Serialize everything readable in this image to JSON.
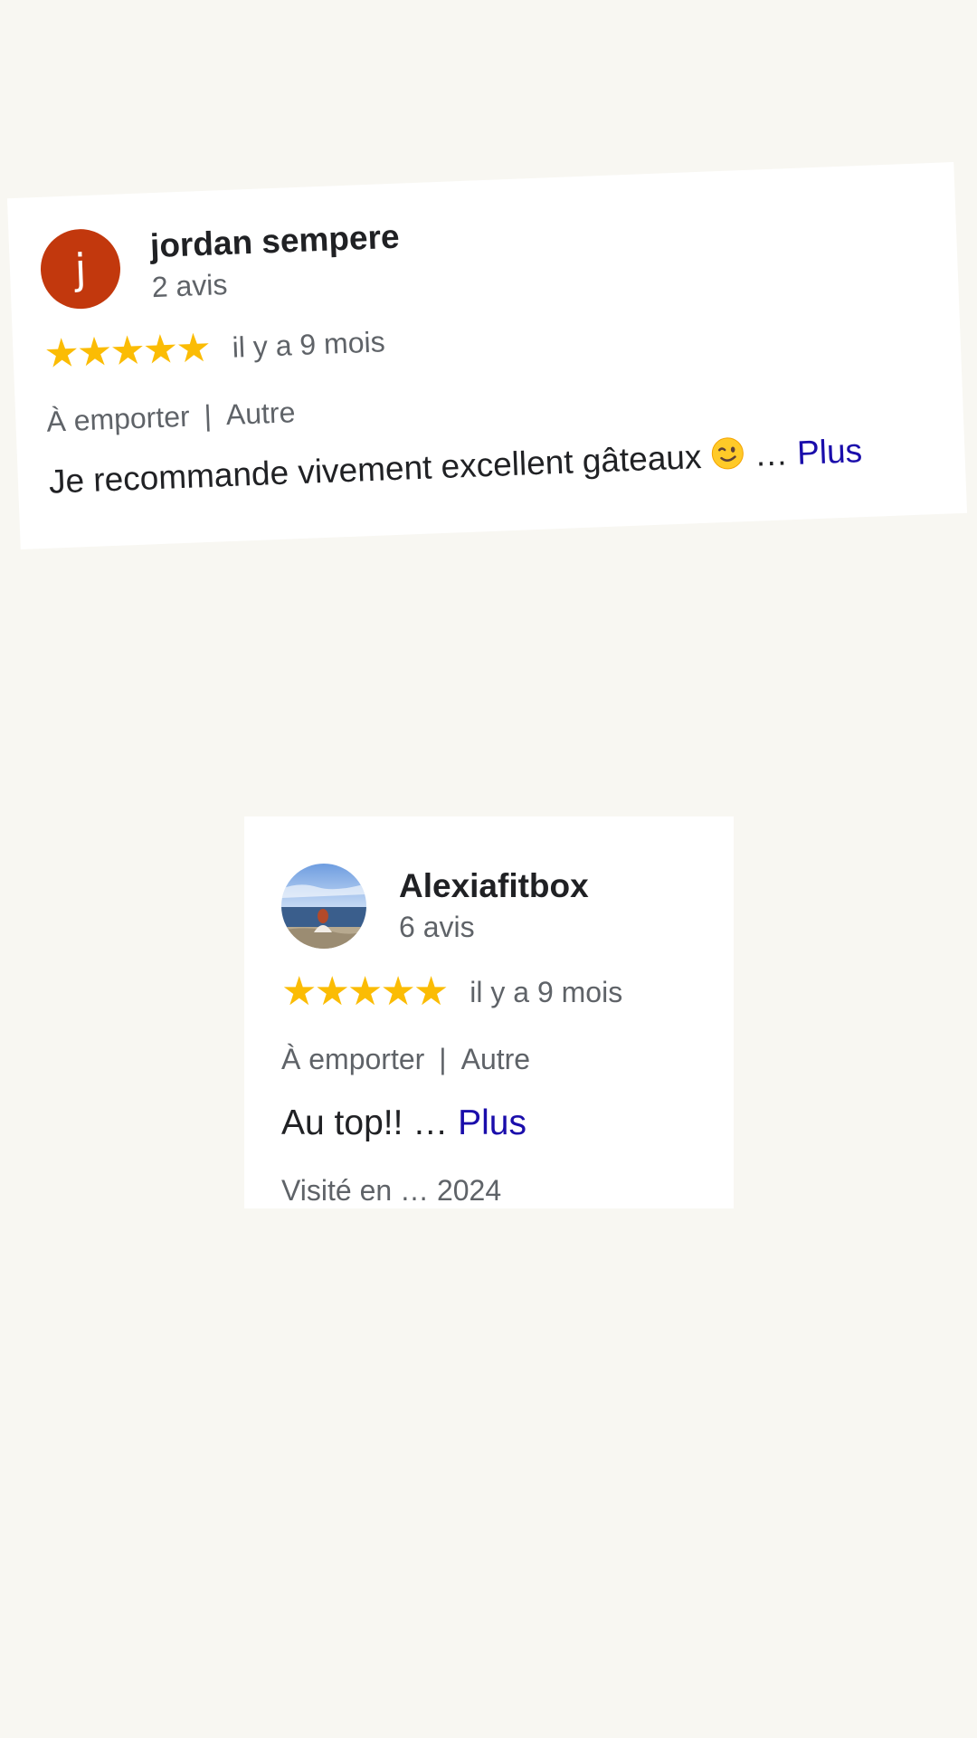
{
  "reviews": [
    {
      "avatar_letter": "j",
      "avatar_color": "#c2380d",
      "name": "jordan sempere",
      "review_count": "2 avis",
      "stars": 5,
      "date": "il y a 9 mois",
      "service": "À emporter",
      "separator": "|",
      "meal": "Autre",
      "text": "Je recommande vivement excellent gâteaux",
      "emoji": "winking-face",
      "ellipsis": "…",
      "more_label": "Plus"
    },
    {
      "avatar_icon": "profile-photo",
      "name": "Alexiafitbox",
      "review_count": "6 avis",
      "stars": 5,
      "date": "il y a 9 mois",
      "service": "À emporter",
      "separator": "|",
      "meal": "Autre",
      "text": "Au top!!",
      "ellipsis": "…",
      "more_label": "Plus",
      "visited": "Visité en … 2024"
    }
  ],
  "colors": {
    "background": "#f8f7f2",
    "star": "#fbbc04",
    "link": "#1a0dab"
  }
}
